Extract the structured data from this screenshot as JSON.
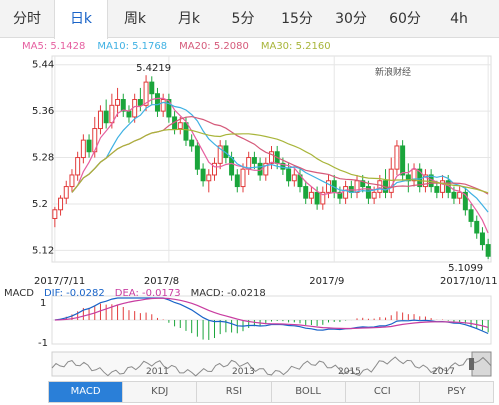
{
  "tabs": [
    "分时",
    "日k",
    "周k",
    "月k",
    "5分",
    "15分",
    "30分",
    "60分",
    "4h"
  ],
  "active_tab": "日k",
  "ma": [
    {
      "label": "MA5: 5.1428",
      "color": "#e65fa0"
    },
    {
      "label": "MA10: 5.1768",
      "color": "#3fb1e3"
    },
    {
      "label": "MA20: 5.2080",
      "color": "#d55a7a"
    },
    {
      "label": "MA30: 5.2160",
      "color": "#a8b53a"
    }
  ],
  "watermark": "新浪财经",
  "colors": {
    "up": "#e23b3b",
    "down": "#1aa53b",
    "grid": "#e6e6e6"
  },
  "chart_data": {
    "type": "candlestick",
    "y_ticks": [
      "5.44",
      "5.36",
      "5.28",
      "5.2",
      "5.12"
    ],
    "ylim": [
      5.1,
      5.455
    ],
    "x_ticks": [
      "2017/7/11",
      "2017/8",
      "2017/9",
      "2017/10/11"
    ],
    "max_label": "5.4219",
    "min_label": "5.1099",
    "candles": [
      [
        5.175,
        5.19,
        5.16,
        5.195
      ],
      [
        5.19,
        5.21,
        5.18,
        5.215
      ],
      [
        5.21,
        5.23,
        5.2,
        5.24
      ],
      [
        5.23,
        5.25,
        5.22,
        5.26
      ],
      [
        5.25,
        5.28,
        5.24,
        5.29
      ],
      [
        5.28,
        5.31,
        5.27,
        5.32
      ],
      [
        5.31,
        5.29,
        5.28,
        5.32
      ],
      [
        5.29,
        5.33,
        5.28,
        5.35
      ],
      [
        5.33,
        5.36,
        5.32,
        5.37
      ],
      [
        5.36,
        5.34,
        5.33,
        5.38
      ],
      [
        5.34,
        5.37,
        5.33,
        5.39
      ],
      [
        5.37,
        5.38,
        5.35,
        5.4
      ],
      [
        5.38,
        5.36,
        5.35,
        5.39
      ],
      [
        5.36,
        5.35,
        5.34,
        5.37
      ],
      [
        5.35,
        5.38,
        5.34,
        5.39
      ],
      [
        5.38,
        5.37,
        5.36,
        5.4
      ],
      [
        5.37,
        5.41,
        5.36,
        5.4219
      ],
      [
        5.41,
        5.39,
        5.37,
        5.42
      ],
      [
        5.39,
        5.36,
        5.35,
        5.4
      ],
      [
        5.36,
        5.38,
        5.35,
        5.39
      ],
      [
        5.38,
        5.35,
        5.34,
        5.39
      ],
      [
        5.35,
        5.33,
        5.32,
        5.36
      ],
      [
        5.33,
        5.34,
        5.32,
        5.35
      ],
      [
        5.34,
        5.31,
        5.3,
        5.35
      ],
      [
        5.31,
        5.3,
        5.29,
        5.32
      ],
      [
        5.3,
        5.26,
        5.25,
        5.31
      ],
      [
        5.26,
        5.24,
        5.23,
        5.27
      ],
      [
        5.24,
        5.25,
        5.22,
        5.26
      ],
      [
        5.25,
        5.27,
        5.24,
        5.28
      ],
      [
        5.27,
        5.3,
        5.26,
        5.31
      ],
      [
        5.3,
        5.28,
        5.27,
        5.31
      ],
      [
        5.28,
        5.25,
        5.24,
        5.29
      ],
      [
        5.25,
        5.23,
        5.22,
        5.26
      ],
      [
        5.23,
        5.26,
        5.22,
        5.27
      ],
      [
        5.26,
        5.28,
        5.25,
        5.29
      ],
      [
        5.28,
        5.27,
        5.26,
        5.29
      ],
      [
        5.27,
        5.25,
        5.24,
        5.28
      ],
      [
        5.25,
        5.27,
        5.24,
        5.28
      ],
      [
        5.27,
        5.29,
        5.26,
        5.3
      ],
      [
        5.29,
        5.27,
        5.26,
        5.3
      ],
      [
        5.27,
        5.26,
        5.25,
        5.28
      ],
      [
        5.26,
        5.24,
        5.23,
        5.27
      ],
      [
        5.24,
        5.25,
        5.23,
        5.26
      ],
      [
        5.25,
        5.23,
        5.22,
        5.26
      ],
      [
        5.23,
        5.21,
        5.2,
        5.24
      ],
      [
        5.21,
        5.22,
        5.2,
        5.23
      ],
      [
        5.22,
        5.2,
        5.19,
        5.23
      ],
      [
        5.2,
        5.22,
        5.19,
        5.23
      ],
      [
        5.22,
        5.24,
        5.21,
        5.25
      ],
      [
        5.24,
        5.22,
        5.21,
        5.25
      ],
      [
        5.22,
        5.21,
        5.2,
        5.23
      ],
      [
        5.21,
        5.23,
        5.2,
        5.24
      ],
      [
        5.23,
        5.22,
        5.21,
        5.24
      ],
      [
        5.22,
        5.24,
        5.21,
        5.25
      ],
      [
        5.24,
        5.23,
        5.22,
        5.25
      ],
      [
        5.23,
        5.21,
        5.2,
        5.24
      ],
      [
        5.21,
        5.22,
        5.2,
        5.23
      ],
      [
        5.22,
        5.24,
        5.21,
        5.25
      ],
      [
        5.24,
        5.22,
        5.21,
        5.26
      ],
      [
        5.22,
        5.26,
        5.21,
        5.28
      ],
      [
        5.26,
        5.3,
        5.25,
        5.31
      ],
      [
        5.3,
        5.25,
        5.24,
        5.31
      ],
      [
        5.25,
        5.24,
        5.22,
        5.27
      ],
      [
        5.24,
        5.26,
        5.23,
        5.27
      ],
      [
        5.26,
        5.23,
        5.22,
        5.27
      ],
      [
        5.23,
        5.25,
        5.22,
        5.26
      ],
      [
        5.25,
        5.23,
        5.22,
        5.26
      ],
      [
        5.23,
        5.22,
        5.21,
        5.24
      ],
      [
        5.22,
        5.24,
        5.21,
        5.25
      ],
      [
        5.24,
        5.22,
        5.21,
        5.25
      ],
      [
        5.22,
        5.21,
        5.2,
        5.23
      ],
      [
        5.21,
        5.22,
        5.2,
        5.23
      ],
      [
        5.22,
        5.19,
        5.18,
        5.23
      ],
      [
        5.19,
        5.17,
        5.16,
        5.2
      ],
      [
        5.17,
        5.15,
        5.14,
        5.18
      ],
      [
        5.15,
        5.13,
        5.12,
        5.16
      ],
      [
        5.13,
        5.1099,
        5.105,
        5.14
      ]
    ]
  },
  "macd_labels": {
    "name": "MACD",
    "dif": "DIF: -0.0282",
    "dea": "DEA: -0.0173",
    "macd": "MACD: -0.0218"
  },
  "macd_ticks": [
    "1",
    "-1"
  ],
  "nav_labels": [
    "2011",
    "2013",
    "2015",
    "2017"
  ],
  "bottom_tabs": [
    "MACD",
    "KDJ",
    "RSI",
    "BOLL",
    "CCI",
    "PSY"
  ],
  "bottom_active": "MACD"
}
